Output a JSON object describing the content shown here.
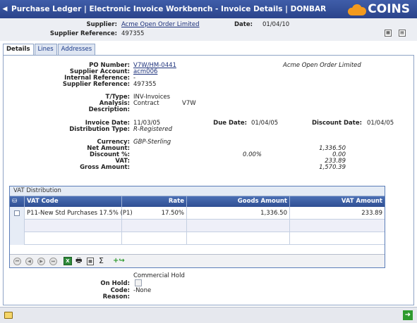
{
  "window": {
    "title": "Purchase Ledger | Electronic Invoice Workbench - Invoice Details | DONBAR",
    "logo_text": "COINS"
  },
  "header": {
    "supplier_label": "Supplier:",
    "supplier_value": "Acme Open Order Limited",
    "date_label": "Date:",
    "date_value": "01/04/10",
    "supplier_ref_label": "Supplier Reference:",
    "supplier_ref_value": "497355"
  },
  "tabs": [
    {
      "label": "Details"
    },
    {
      "label": "Lines"
    },
    {
      "label": "Addresses"
    }
  ],
  "details": {
    "po_number_label": "PO Number:",
    "po_number_value": "V7W/HM-0441",
    "supplier_name": "Acme Open Order Limited",
    "supplier_account_label": "Supplier Account:",
    "supplier_account_value": "acm006",
    "internal_ref_label": "Internal Reference:",
    "internal_ref_value": "-",
    "supplier_ref_label": "Supplier Reference:",
    "supplier_ref_value": "497355",
    "ttype_label": "T/Type:",
    "ttype_value": "INV-Invoices",
    "analysis_label": "Analysis:",
    "analysis_value": "Contract",
    "analysis_code": "V7W",
    "description_label": "Description:",
    "invoice_date_label": "Invoice Date:",
    "invoice_date_value": "11/03/05",
    "due_date_label": "Due Date:",
    "due_date_value": "01/04/05",
    "discount_date_label": "Discount Date:",
    "discount_date_value": "01/04/05",
    "distribution_type_label": "Distribution Type:",
    "distribution_type_value": "R-Registered",
    "currency_label": "Currency:",
    "currency_value": "GBP-Sterling",
    "net_amount_label": "Net Amount:",
    "net_amount_value": "1,336.50",
    "discount_pct_label": "Discount %:",
    "discount_pct_value": "0.00%",
    "discount_amount_value": "0.00",
    "vat_label": "VAT:",
    "vat_value": "233.89",
    "gross_amount_label": "Gross Amount:",
    "gross_amount_value": "1,570.39"
  },
  "vat_distribution": {
    "title": "VAT Distribution",
    "columns": [
      "VAT Code",
      "Rate",
      "Goods Amount",
      "VAT Amount"
    ],
    "rows": [
      {
        "code": "P11-New Std Purchases 17.5% (P1)",
        "rate": "17.50%",
        "goods": "1,336.50",
        "vat": "233.89"
      }
    ]
  },
  "hold": {
    "heading": "Commercial Hold",
    "on_hold_label": "On Hold:",
    "code_label": "Code:",
    "code_value": "-None",
    "reason_label": "Reason:"
  },
  "colors": {
    "titlebar": "#2b448b",
    "accent_orange": "#f39a1e",
    "grid_header": "#3f5fa5"
  }
}
